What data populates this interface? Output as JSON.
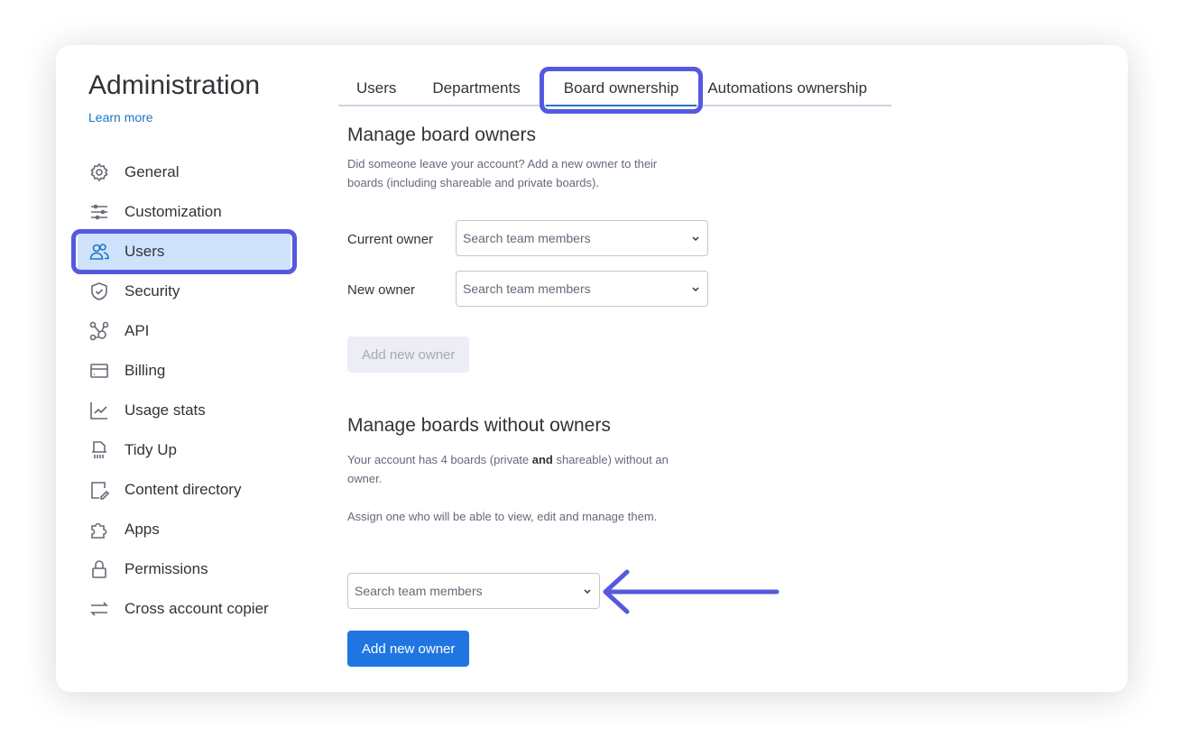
{
  "sidebar": {
    "title": "Administration",
    "learn_more": "Learn more",
    "items": [
      {
        "label": "General",
        "icon": "gear-icon"
      },
      {
        "label": "Customization",
        "icon": "sliders-icon"
      },
      {
        "label": "Users",
        "icon": "users-icon",
        "active": true
      },
      {
        "label": "Security",
        "icon": "shield-icon"
      },
      {
        "label": "API",
        "icon": "api-icon"
      },
      {
        "label": "Billing",
        "icon": "credit-card-icon"
      },
      {
        "label": "Usage stats",
        "icon": "chart-icon"
      },
      {
        "label": "Tidy Up",
        "icon": "shredder-icon"
      },
      {
        "label": "Content directory",
        "icon": "edit-document-icon"
      },
      {
        "label": "Apps",
        "icon": "puzzle-icon"
      },
      {
        "label": "Permissions",
        "icon": "lock-icon"
      },
      {
        "label": "Cross account copier",
        "icon": "swap-icon"
      }
    ]
  },
  "tabs": [
    {
      "label": "Users"
    },
    {
      "label": "Departments"
    },
    {
      "label": "Board ownership",
      "active": true
    },
    {
      "label": "Automations ownership"
    }
  ],
  "manage_owners": {
    "title": "Manage board owners",
    "description": "Did someone leave your account? Add a new owner to their boards (including shareable and private boards).",
    "current_owner_label": "Current owner",
    "new_owner_label": "New owner",
    "placeholder": "Search team members",
    "button": "Add new owner"
  },
  "without_owners": {
    "title": "Manage boards without owners",
    "desc_pre": "Your account has 4 boards (private ",
    "desc_bold": "and",
    "desc_post": " shareable) without an owner.",
    "assign": "Assign one who will be able to view, edit and manage them.",
    "placeholder": "Search team members",
    "button": "Add new owner"
  },
  "colors": {
    "highlight": "#5559df",
    "primary": "#1f76e2",
    "active_bg": "#cfe2fb"
  }
}
